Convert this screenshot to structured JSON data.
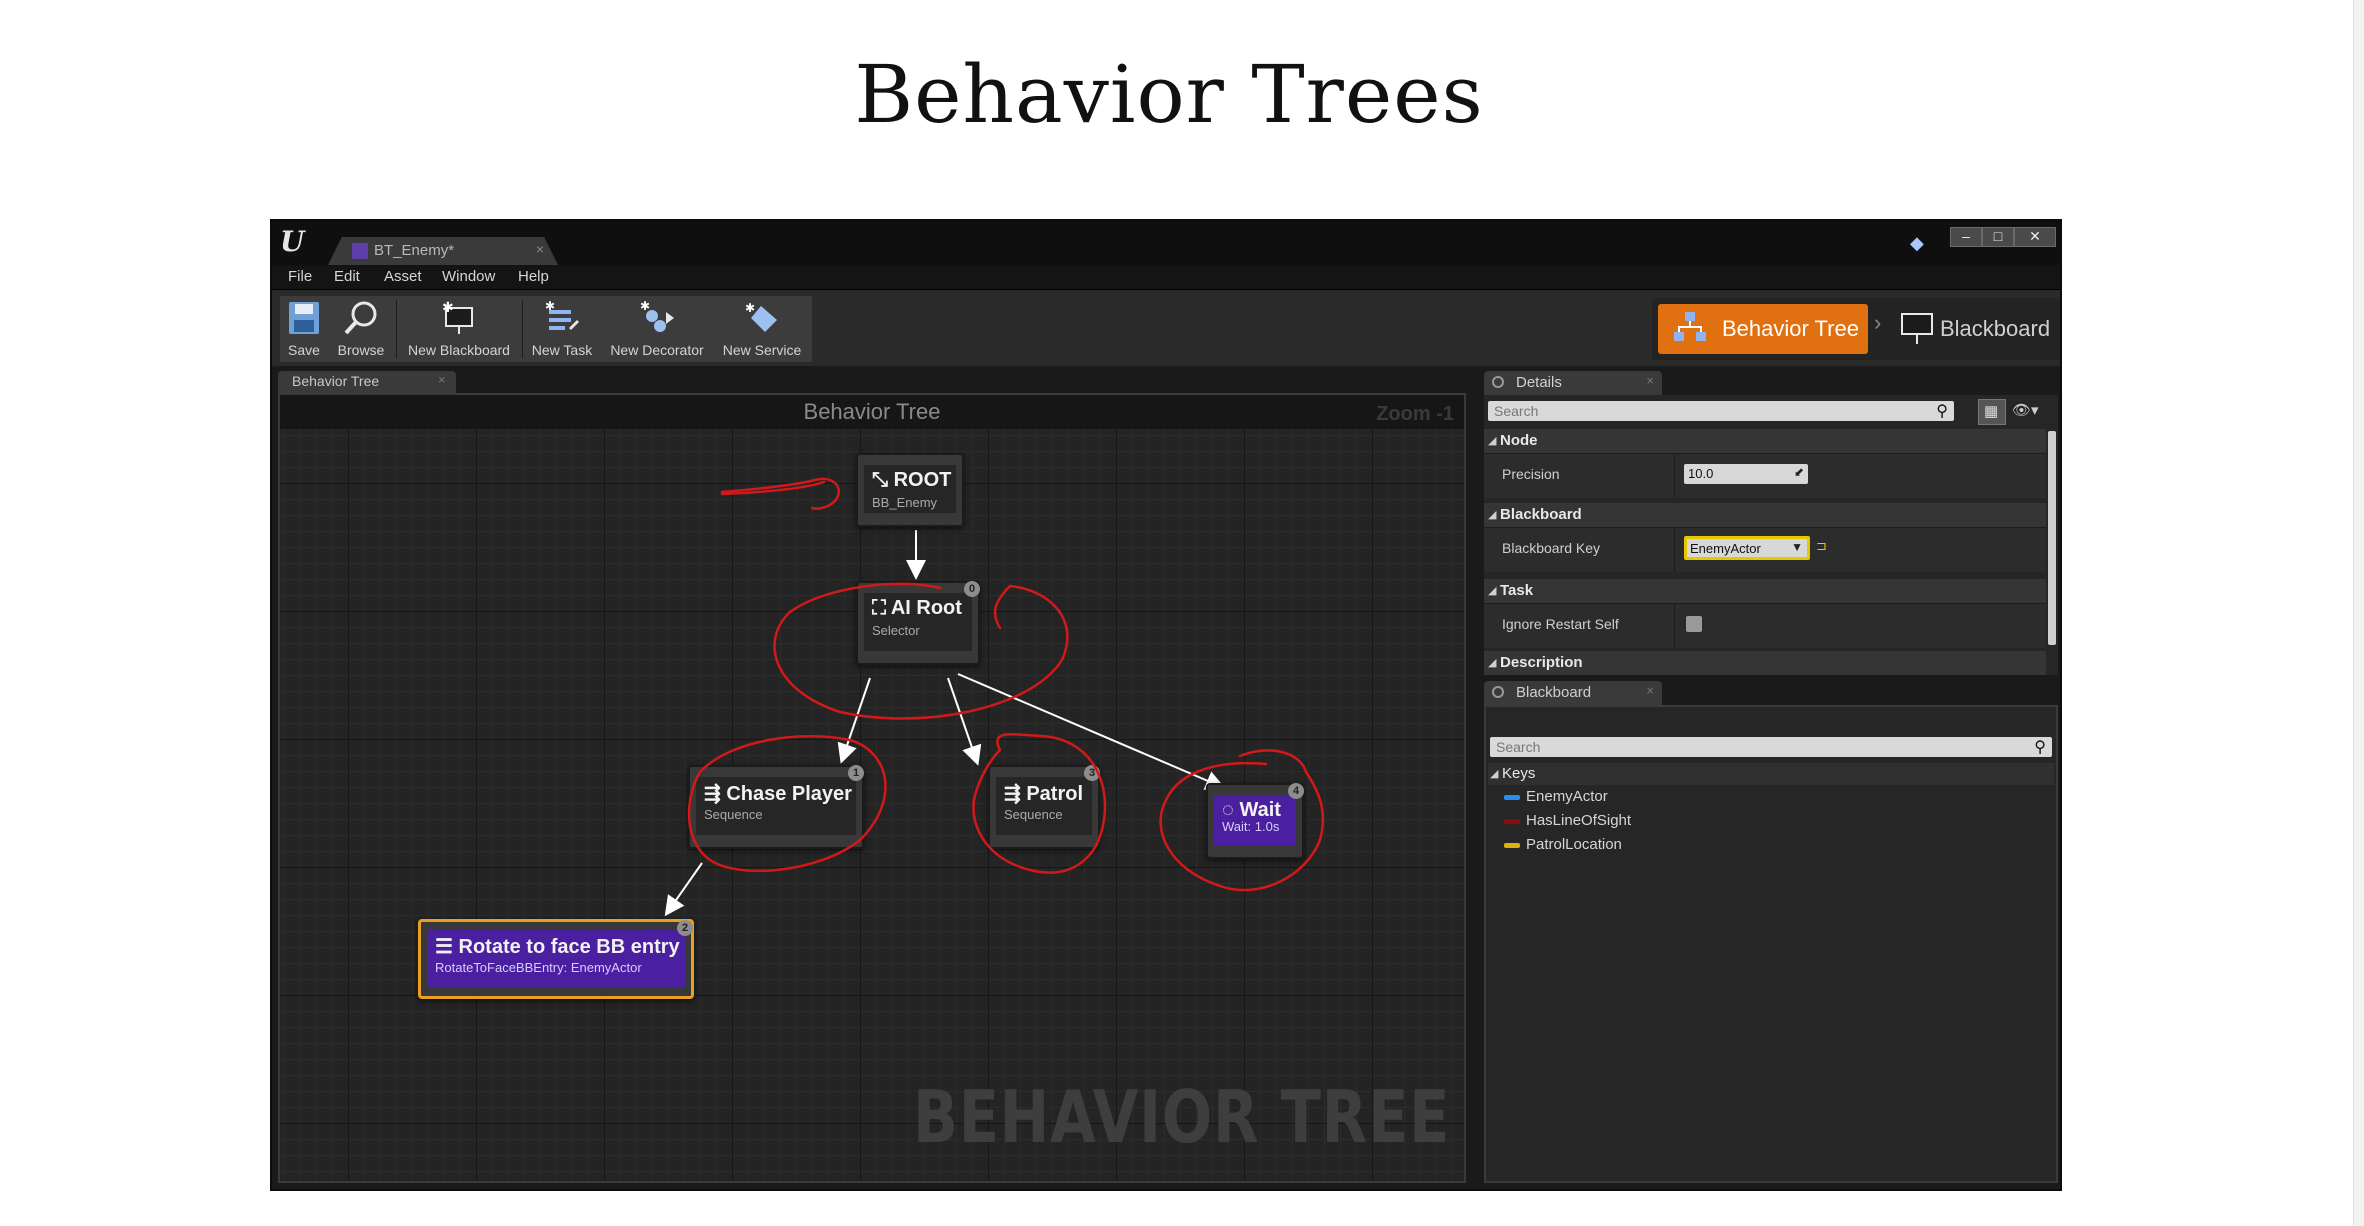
{
  "slide": {
    "title": "Behavior Trees"
  },
  "window": {
    "doc_tab": "BT_Enemy*",
    "menu": [
      "File",
      "Edit",
      "Asset",
      "Window",
      "Help"
    ],
    "win_buttons": [
      "–",
      "□",
      "✕"
    ]
  },
  "toolbar": {
    "buttons": [
      {
        "label": "Save",
        "icon": "save-icon"
      },
      {
        "label": "Browse",
        "icon": "browse-icon"
      },
      {
        "label": "New Blackboard",
        "icon": "new-blackboard-icon"
      },
      {
        "label": "New Task",
        "icon": "new-task-icon"
      },
      {
        "label": "New Decorator",
        "icon": "new-decorator-icon"
      },
      {
        "label": "New Service",
        "icon": "new-service-icon"
      }
    ],
    "mode_active": "Behavior Tree",
    "mode_other": "Blackboard",
    "accent": "#e07010"
  },
  "graph": {
    "tab": "Behavior Tree",
    "title": "Behavior Tree",
    "zoom": "Zoom -1",
    "watermark": "BEHAVIOR TREE",
    "nodes": {
      "root": {
        "title": "ROOT",
        "sub": "BB_Enemy"
      },
      "ai_root": {
        "title": "AI Root",
        "sub": "Selector",
        "badge": "0"
      },
      "chase": {
        "title": "Chase Player",
        "sub": "Sequence",
        "badge": "1"
      },
      "patrol": {
        "title": "Patrol",
        "sub": "Sequence",
        "badge": "3"
      },
      "wait": {
        "title": "Wait",
        "sub": "Wait: 1.0s",
        "badge": "4"
      },
      "rotate": {
        "title": "Rotate to face BB entry",
        "sub": "RotateToFaceBBEntry: EnemyActor",
        "badge": "2"
      }
    },
    "task_color": "#4a1fa0",
    "selected_color": "#e8a020",
    "annotation_color": "#d01a1a"
  },
  "details": {
    "tab": "Details",
    "search_placeholder": "Search",
    "categories": {
      "node": "Node",
      "blackboard": "Blackboard",
      "task": "Task",
      "description": "Description"
    },
    "props": {
      "precision_label": "Precision",
      "precision_value": "10.0",
      "bb_key_label": "Blackboard Key",
      "bb_key_value": "EnemyActor",
      "ignore_restart_label": "Ignore Restart Self"
    }
  },
  "blackboard": {
    "tab": "Blackboard",
    "search_placeholder": "Search",
    "keys_header": "Keys",
    "keys": [
      {
        "name": "EnemyActor",
        "color": "#2a8cf0"
      },
      {
        "name": "HasLineOfSight",
        "color": "#8a0c0c"
      },
      {
        "name": "PatrolLocation",
        "color": "#e0b010"
      }
    ]
  }
}
